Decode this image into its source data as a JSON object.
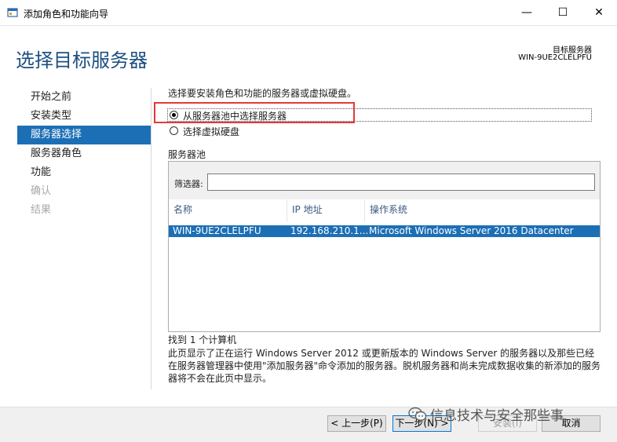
{
  "window": {
    "title": "添加角色和功能向导",
    "minimize_glyph": "—",
    "maximize_glyph": "☐",
    "close_glyph": "✕"
  },
  "header": {
    "page_title": "选择目标服务器",
    "target_label": "目标服务器",
    "target_name": "WIN-9UE2CLELPFU"
  },
  "nav": {
    "items": [
      {
        "label": "开始之前",
        "state": "normal"
      },
      {
        "label": "安装类型",
        "state": "normal"
      },
      {
        "label": "服务器选择",
        "state": "active"
      },
      {
        "label": "服务器角色",
        "state": "normal"
      },
      {
        "label": "功能",
        "state": "normal"
      },
      {
        "label": "确认",
        "state": "disabled"
      },
      {
        "label": "结果",
        "state": "disabled"
      }
    ]
  },
  "main": {
    "instruction": "选择要安装角色和功能的服务器或虚拟硬盘。",
    "radio_pool": {
      "label": "从服务器池中选择服务器",
      "checked": true
    },
    "radio_vhd": {
      "label": "选择虚拟硬盘",
      "checked": false
    },
    "pool_heading": "服务器池",
    "filter_label": "筛选器:",
    "filter_value": "",
    "columns": [
      "名称",
      "IP 地址",
      "操作系统"
    ],
    "rows": [
      {
        "name": "WIN-9UE2CLELPFU",
        "ip": "192.168.210.1...",
        "os": "Microsoft Windows Server 2016 Datacenter",
        "selected": true
      }
    ],
    "found_text": "找到 1 个计算机",
    "info_text": "此页显示了正在运行 Windows Server 2012 或更新版本的 Windows Server 的服务器以及那些已经在服务器管理器中使用\"添加服务器\"命令添加的服务器。脱机服务器和尚未完成数据收集的新添加的服务器将不会在此页中显示。"
  },
  "buttons": {
    "previous": "< 上一步(P)",
    "next": "下一步(N) >",
    "install": "安装(I)",
    "cancel": "取消"
  },
  "watermark": "信息技术与安全那些事",
  "colors": {
    "accent": "#1c6fb5",
    "title_blue": "#1c4f80",
    "highlight_red": "#e23a3a"
  }
}
